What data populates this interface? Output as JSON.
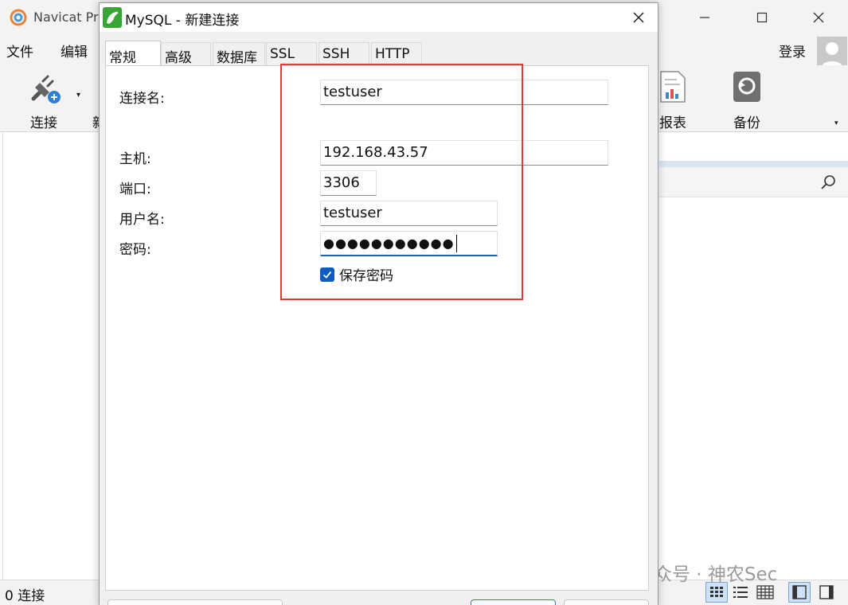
{
  "app": {
    "title": "Navicat Pr",
    "menu": [
      "文件",
      "编辑"
    ],
    "login_label": "登录",
    "toolbar": [
      {
        "label": "连接",
        "icon": "plug-add-icon"
      },
      {
        "label": "新",
        "icon": "new-icon"
      },
      {
        "label": "报表",
        "icon": "report-icon"
      },
      {
        "label": "备份",
        "icon": "backup-icon"
      }
    ],
    "status": "0 连接",
    "watermark": "公众号 · 神农Sec"
  },
  "dialog": {
    "title": "MySQL - 新建连接",
    "tabs": [
      "常规",
      "高级",
      "数据库",
      "SSL",
      "SSH",
      "HTTP"
    ],
    "active_tab": "常规",
    "fields": {
      "connection_name": {
        "label": "连接名:",
        "value": "testuser"
      },
      "host": {
        "label": "主机:",
        "value": "192.168.43.57"
      },
      "port": {
        "label": "端口:",
        "value": "3306"
      },
      "username": {
        "label": "用户名:",
        "value": "testuser"
      },
      "password": {
        "label": "密码:",
        "value": "●●●●●●●●●●●"
      }
    },
    "save_password": {
      "label": "保存密码",
      "checked": true
    }
  },
  "colors": {
    "highlight": "#e33a3a",
    "checkbox": "#0f5cc0",
    "accent_focus": "#1e63b8",
    "mysql_icon": "#38a634"
  }
}
